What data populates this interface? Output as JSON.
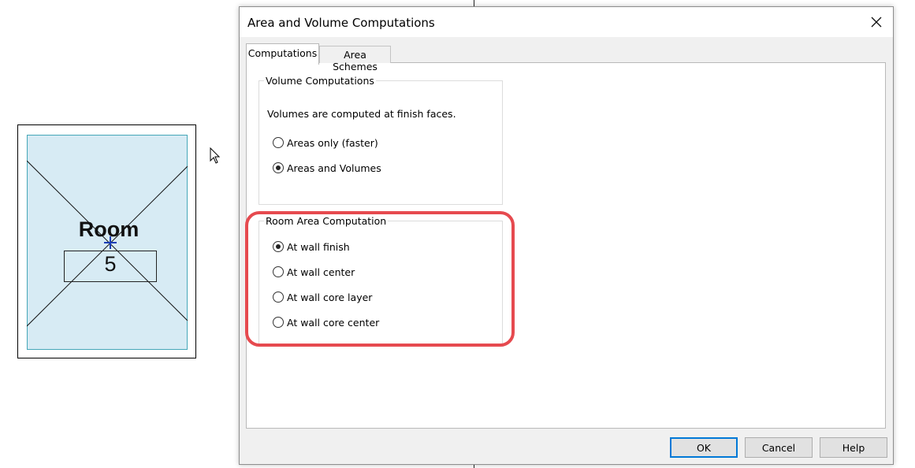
{
  "dialog": {
    "title": "Area and Volume Computations",
    "close_icon": "close-icon"
  },
  "tabs": [
    {
      "label": "Computations",
      "active": true
    },
    {
      "label": "Area Schemes",
      "active": false
    }
  ],
  "volume_group": {
    "legend": "Volume Computations",
    "description": "Volumes are computed at finish faces.",
    "options": [
      {
        "label": "Areas only (faster)",
        "selected": false
      },
      {
        "label": "Areas and Volumes",
        "selected": true
      }
    ]
  },
  "room_area_group": {
    "legend": "Room Area Computation",
    "options": [
      {
        "label": "At wall finish",
        "selected": true
      },
      {
        "label": "At wall center",
        "selected": false
      },
      {
        "label": "At wall core layer",
        "selected": false
      },
      {
        "label": "At wall core center",
        "selected": false
      }
    ],
    "highlight_color": "#e64a4f"
  },
  "buttons": {
    "ok": "OK",
    "cancel": "Cancel",
    "help": "Help"
  },
  "room": {
    "name": "Room",
    "number": "5",
    "fill_color": "#d7ebf4",
    "border_color": "#45a7b8"
  },
  "colors": {
    "accent": "#0078d7",
    "dialog_bg": "#f0f0f0"
  }
}
